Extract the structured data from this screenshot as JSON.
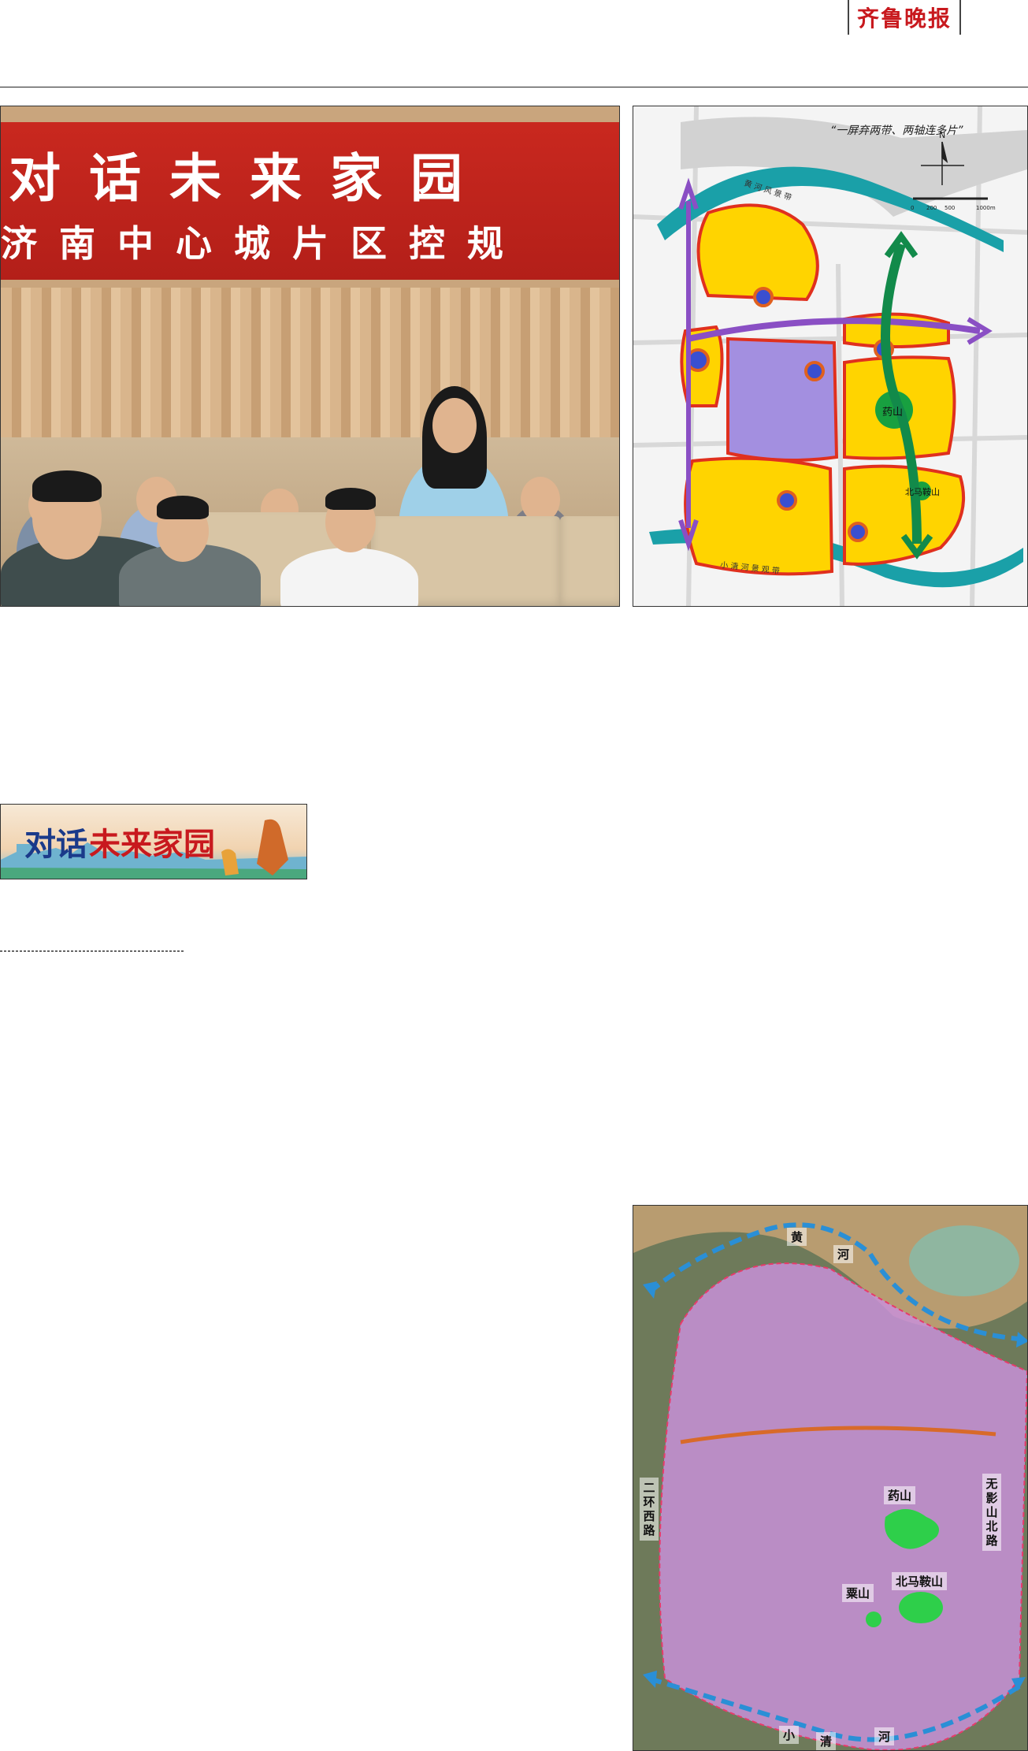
{
  "masthead": {
    "name": "齐鲁晚报"
  },
  "photo": {
    "banner_line1": "对话未来家园",
    "banner_line2": "济南中心城片区控规"
  },
  "plan_map": {
    "title": "“一屏弃两带、两轴连多片”",
    "north": "N",
    "scale_labels": [
      "0",
      "200",
      "500",
      "1000m"
    ],
    "label_yaoshan": "药山",
    "label_beimaanshan": "北马鞍山",
    "river_top": "黄 河 风 景 带",
    "river_bottom": "小 清 河 景 观 带",
    "colors": {
      "zone": "#ffd400",
      "core": "#a38fe0",
      "axis_purple": "#8a4fc4",
      "axis_green": "#128a4a",
      "water": "#1aa0a8"
    }
  },
  "column": {
    "title_part1": "对话",
    "title_part2": "未来家园"
  },
  "sat_map": {
    "river_top": "黄",
    "river_top2": "河",
    "road_left": "二环西路",
    "road_right": "无影山北路",
    "hill_yaoshan": "药山",
    "hill_beimaanshan": "北马鞍山",
    "hill_sushan": "粟山",
    "river_bottom1": "小",
    "river_bottom2": "清",
    "river_bottom3": "河",
    "colors": {
      "overlay": "#e890d0",
      "route": "#2a8fd6",
      "green": "#2ecf4a"
    }
  }
}
